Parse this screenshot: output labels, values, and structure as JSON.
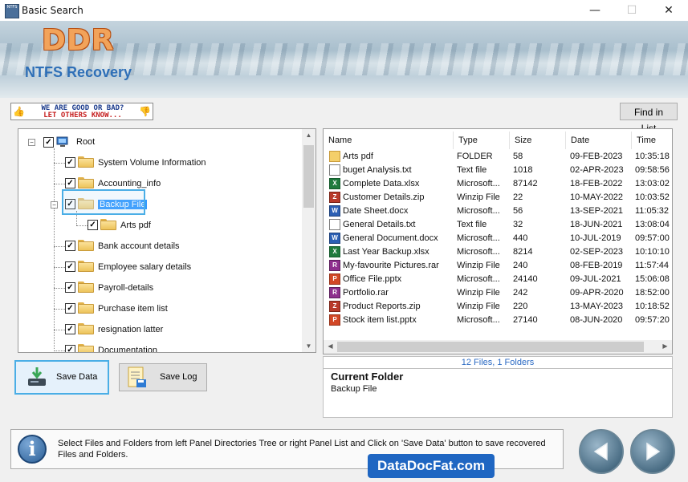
{
  "window": {
    "title": "Basic Search",
    "app_icon_text": "NTFS",
    "minimize": "—",
    "maximize": "☐",
    "close": "✕"
  },
  "banner": {
    "logo": "DDR",
    "product": "NTFS Recovery"
  },
  "feedback": {
    "line1": "WE ARE GOOD OR BAD?",
    "line2": "LET OTHERS KNOW..."
  },
  "find_button": "Find in List",
  "tree": {
    "root": "Root",
    "items": [
      "System Volume Information",
      "Accounting_info",
      "Backup File",
      "Arts pdf",
      "Bank account details",
      "Employee salary details",
      "Payroll-details",
      "Purchase item list",
      "resignation latter",
      "Documentation"
    ]
  },
  "list": {
    "columns": [
      "Name",
      "Type",
      "Size",
      "Date",
      "Time"
    ],
    "rows": [
      {
        "name": "Arts pdf",
        "type": "FOLDER",
        "size": "58",
        "date": "09-FEB-2023",
        "time": "10:35:18",
        "icon": "folder"
      },
      {
        "name": "buget Analysis.txt",
        "type": "Text file",
        "size": "1018",
        "date": "02-APR-2023",
        "time": "09:58:56",
        "icon": "txt"
      },
      {
        "name": "Complete Data.xlsx",
        "type": "Microsoft...",
        "size": "87142",
        "date": "18-FEB-2022",
        "time": "13:03:02",
        "icon": "xlsx"
      },
      {
        "name": "Customer Details.zip",
        "type": "Winzip File",
        "size": "22",
        "date": "10-MAY-2022",
        "time": "10:03:52",
        "icon": "zip"
      },
      {
        "name": "Date Sheet.docx",
        "type": "Microsoft...",
        "size": "56",
        "date": "13-SEP-2021",
        "time": "11:05:32",
        "icon": "docx"
      },
      {
        "name": "General Details.txt",
        "type": "Text file",
        "size": "32",
        "date": "18-JUN-2021",
        "time": "13:08:04",
        "icon": "txt"
      },
      {
        "name": "General Document.docx",
        "type": "Microsoft...",
        "size": "440",
        "date": "10-JUL-2019",
        "time": "09:57:00",
        "icon": "docx"
      },
      {
        "name": "Last Year Backup.xlsx",
        "type": "Microsoft...",
        "size": "8214",
        "date": "02-SEP-2023",
        "time": "10:10:10",
        "icon": "xlsx"
      },
      {
        "name": "My-favourite Pictures.rar",
        "type": "Winzip File",
        "size": "240",
        "date": "08-FEB-2019",
        "time": "11:57:44",
        "icon": "rar"
      },
      {
        "name": "Office File.pptx",
        "type": "Microsoft...",
        "size": "24140",
        "date": "09-JUL-2021",
        "time": "15:06:08",
        "icon": "pptx"
      },
      {
        "name": "Portfolio.rar",
        "type": "Winzip File",
        "size": "242",
        "date": "09-APR-2020",
        "time": "18:52:00",
        "icon": "rar"
      },
      {
        "name": "Product Reports.zip",
        "type": "Winzip File",
        "size": "220",
        "date": "13-MAY-2023",
        "time": "10:18:52",
        "icon": "zip"
      },
      {
        "name": "Stock item list.pptx",
        "type": "Microsoft...",
        "size": "27140",
        "date": "08-JUN-2020",
        "time": "09:57:20",
        "icon": "pptx"
      }
    ]
  },
  "status": "12 Files, 1 Folders",
  "current_folder": {
    "title": "Current Folder",
    "value": "Backup File"
  },
  "buttons": {
    "save_data": "Save Data",
    "save_log": "Save Log"
  },
  "info": {
    "icon": "i",
    "text": "Select Files and Folders from left Panel Directories Tree or right Panel List and Click on 'Save Data' button to save recovered Files and Folders."
  },
  "watermark": "DataDocFat.com"
}
